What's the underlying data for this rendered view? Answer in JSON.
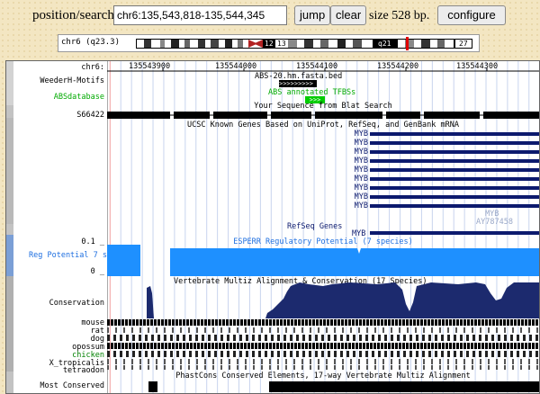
{
  "nav": {
    "label": "position/search",
    "position_value": "chr6:135,543,818-135,544,345",
    "jump_label": "jump",
    "clear_label": "clear",
    "size_text": "size 528 bp.",
    "configure_label": "configure"
  },
  "ideogram": {
    "chrom_label": "chr6 (q23.3)",
    "band_labels": [
      "12",
      "13",
      "q21",
      "27"
    ]
  },
  "ruler": {
    "label": "chr6:",
    "ticks": [
      "135543900",
      "135544000",
      "135544100",
      "135544200",
      "135544300"
    ]
  },
  "tracks": {
    "weeder_label": "WeederH-Motifs",
    "weeder_feature": "ABS-20.hm.fasta.bed",
    "abs_label": "ABSdatabase",
    "abs_feature": "ABS annotated TFBSs",
    "blat_title": "Your Sequence from Blat Search",
    "blat_label": "S66422",
    "ucsc_title": "UCSC Known Genes Based on UniProt, RefSeq, and GenBank mRNA",
    "myb_labels": [
      "MYB",
      "MYB",
      "MYB",
      "MYB",
      "MYB",
      "MYB",
      "MYB",
      "MYB",
      "MYB"
    ],
    "myb_gray": "MYB",
    "ay_label": "AY787458",
    "refseq_title": "RefSeq Genes",
    "refseq_gene": "MYB",
    "esperr_title": "ESPERR Regulatory Potential (7 species)",
    "esperr_top": "0.1 _",
    "esperr_label": "Reg Potential 7 s",
    "esperr_bottom": "0 _",
    "cons_title": "Vertebrate Multiz Alignment & Conservation (17 Species)",
    "cons_label": "Conservation",
    "species": [
      "mouse",
      "rat",
      "dog",
      "opossum",
      "chicken",
      "X_tropicalis",
      "tetraodon"
    ],
    "phast_title": "PhastCons Conserved Elements, 17-way Vertebrate Multiz Alignment",
    "phast_label": "Most Conserved"
  },
  "colors": {
    "gene_navy": "#0c1a6e",
    "reg_blue": "#1e90ff",
    "cons_navy": "#1c2a6e",
    "abs_green": "#00cc00",
    "label_green": "#00aa00",
    "blat_black": "#000000",
    "chicken_green": "#008000",
    "ideo_red": "#e00000"
  }
}
